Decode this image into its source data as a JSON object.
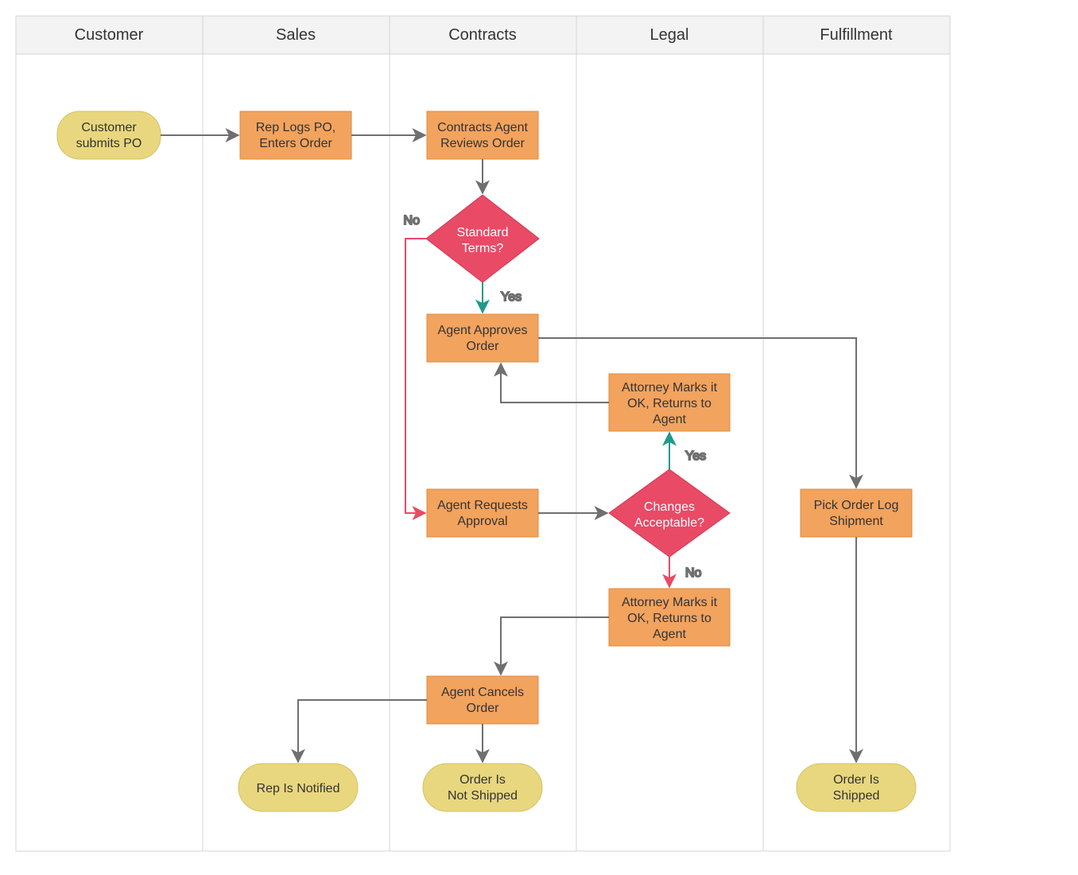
{
  "lanes": [
    {
      "id": "customer",
      "label": "Customer"
    },
    {
      "id": "sales",
      "label": "Sales"
    },
    {
      "id": "contracts",
      "label": "Contracts"
    },
    {
      "id": "legal",
      "label": "Legal"
    },
    {
      "id": "fulfillment",
      "label": "Fulfillment"
    }
  ],
  "nodes": {
    "start": {
      "type": "terminator",
      "lane": "customer",
      "lines": [
        "Customer",
        "submits PO"
      ]
    },
    "repLogs": {
      "type": "process",
      "lane": "sales",
      "lines": [
        "Rep Logs PO,",
        "Enters Order"
      ]
    },
    "review": {
      "type": "process",
      "lane": "contracts",
      "lines": [
        "Contracts Agent",
        "Reviews Order"
      ]
    },
    "stdTerms": {
      "type": "decision",
      "lane": "contracts",
      "lines": [
        "Standard",
        "Terms?"
      ]
    },
    "approve": {
      "type": "process",
      "lane": "contracts",
      "lines": [
        "Agent Approves",
        "Order"
      ]
    },
    "attOk": {
      "type": "process",
      "lane": "legal",
      "lines": [
        "Attorney Marks it",
        "OK, Returns to",
        "Agent"
      ]
    },
    "reqApproval": {
      "type": "process",
      "lane": "contracts",
      "lines": [
        "Agent Requests",
        "Approval"
      ]
    },
    "changes": {
      "type": "decision",
      "lane": "legal",
      "lines": [
        "Changes",
        "Acceptable?"
      ]
    },
    "attOk2": {
      "type": "process",
      "lane": "legal",
      "lines": [
        "Attorney Marks it",
        "OK, Returns to",
        "Agent"
      ]
    },
    "cancel": {
      "type": "process",
      "lane": "contracts",
      "lines": [
        "Agent Cancels",
        "Order"
      ]
    },
    "pick": {
      "type": "process",
      "lane": "fulfillment",
      "lines": [
        "Pick Order Log",
        "Shipment"
      ]
    },
    "repNotified": {
      "type": "terminator",
      "lane": "sales",
      "lines": [
        "Rep Is Notified"
      ]
    },
    "notShipped": {
      "type": "terminator",
      "lane": "contracts",
      "lines": [
        "Order Is",
        "Not Shipped"
      ]
    },
    "shipped": {
      "type": "terminator",
      "lane": "fulfillment",
      "lines": [
        "Order Is",
        "Shipped"
      ]
    }
  },
  "edge_labels": {
    "yes": "Yes",
    "no": "No"
  },
  "colors": {
    "lane_header": "#f3f3f3",
    "lane_border": "#d6d6d6",
    "process_fill": "#f2a35e",
    "process_stroke": "#e08a3b",
    "terminator_fill": "#e8d77e",
    "terminator_stroke": "#d4c25f",
    "decision_fill": "#e94a66",
    "decision_stroke": "#d03a56",
    "arrow": "#6f6f6f",
    "yes": "#1f9a8c",
    "no": "#e94a66"
  }
}
